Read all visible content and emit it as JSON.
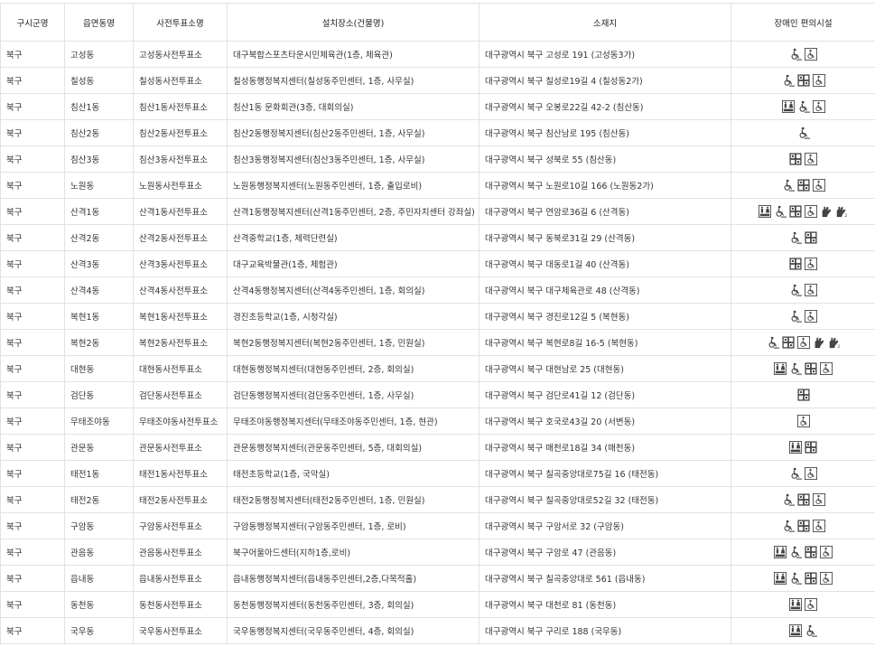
{
  "headers": [
    "구시군명",
    "읍면동명",
    "사전투표소명",
    "설치장소(건물명)",
    "소재지",
    "장애인 편의시설"
  ],
  "rows": [
    {
      "gu": "북구",
      "dong": "고성동",
      "booth": "고성동사전투표소",
      "place": "대구북합스포츠타운시민체육관(1층, 체육관)",
      "addr": "대구광역시 북구 고성로 191 (고성동3가)",
      "icons": [
        "wheelchair-ramp",
        "wheelchair-sign"
      ]
    },
    {
      "gu": "북구",
      "dong": "칠성동",
      "booth": "칠성동사전투표소",
      "place": "칠성동행정복지센터(칠성동주민센터, 1층, 사무실)",
      "addr": "대구광역시 북구 칠성로19길 4 (칠성동2가)",
      "icons": [
        "wheelchair-ramp",
        "elevator",
        "wheelchair-sign"
      ]
    },
    {
      "gu": "북구",
      "dong": "침산1동",
      "booth": "침산1동사전투표소",
      "place": "침산1동 문화회관(3층, 대회의실)",
      "addr": "대구광역시 북구 오봉로22길 42-2 (침산동)",
      "icons": [
        "restroom",
        "wheelchair-ramp",
        "wheelchair-sign"
      ]
    },
    {
      "gu": "북구",
      "dong": "침산2동",
      "booth": "침산2동사전투표소",
      "place": "침산2동행정복지센터(침산2동주민센터, 1층, 사무실)",
      "addr": "대구광역시 북구 침산남로 195 (침산동)",
      "icons": [
        "wheelchair-ramp"
      ]
    },
    {
      "gu": "북구",
      "dong": "침산3동",
      "booth": "침산3동사전투표소",
      "place": "침산3동행정복지센터(침산3동주민센터, 1층, 사무실)",
      "addr": "대구광역시 북구 성북로 55 (침산동)",
      "icons": [
        "elevator",
        "wheelchair-sign"
      ]
    },
    {
      "gu": "북구",
      "dong": "노원동",
      "booth": "노원동사전투표소",
      "place": "노원동행정복지센터(노원동주민센터, 1층, 출입로비)",
      "addr": "대구광역시 북구 노원로10길 166 (노원동2가)",
      "icons": [
        "wheelchair-ramp",
        "elevator",
        "wheelchair-sign"
      ]
    },
    {
      "gu": "북구",
      "dong": "산격1동",
      "booth": "산격1동사전투표소",
      "place": "산격1동행정복지센터(산격1동주민센터, 2층, 주민자치센터 강좌실)",
      "addr": "대구광역시 북구 연암로36길 6 (산격동)",
      "icons": [
        "restroom",
        "wheelchair-ramp",
        "elevator",
        "wheelchair-sign",
        "hand-support",
        "hand-support-2"
      ]
    },
    {
      "gu": "북구",
      "dong": "산격2동",
      "booth": "산격2동사전투표소",
      "place": "산격중학교(1층, 체력단련실)",
      "addr": "대구광역시 북구 동북로31길 29 (산격동)",
      "icons": [
        "wheelchair-ramp",
        "elevator"
      ]
    },
    {
      "gu": "북구",
      "dong": "산격3동",
      "booth": "산격3동사전투표소",
      "place": "대구교육박물관(1층, 체험관)",
      "addr": "대구광역시 북구 대동로1길 40 (산격동)",
      "icons": [
        "elevator",
        "wheelchair-sign"
      ]
    },
    {
      "gu": "북구",
      "dong": "산격4동",
      "booth": "산격4동사전투표소",
      "place": "산격4동행정복지센터(산격4동주민센터, 1층, 회의실)",
      "addr": "대구광역시 북구 대구체육관로 48 (산격동)",
      "icons": [
        "wheelchair-ramp",
        "wheelchair-sign"
      ]
    },
    {
      "gu": "북구",
      "dong": "복현1동",
      "booth": "복현1동사전투표소",
      "place": "경진초등학교(1층, 시청각실)",
      "addr": "대구광역시 북구 경진로12길 5 (복현동)",
      "icons": [
        "wheelchair-ramp",
        "wheelchair-sign"
      ]
    },
    {
      "gu": "북구",
      "dong": "복현2동",
      "booth": "복현2동사전투표소",
      "place": "복현2동행정복지센터(복현2동주민센터, 1층, 민원실)",
      "addr": "대구광역시 북구 복현로8길 16-5 (복현동)",
      "icons": [
        "wheelchair-ramp",
        "elevator",
        "wheelchair-sign",
        "hand-support",
        "hand-support-2"
      ]
    },
    {
      "gu": "북구",
      "dong": "대현동",
      "booth": "대현동사전투표소",
      "place": "대현동행정복지센터(대현동주민센터, 2층, 회의실)",
      "addr": "대구광역시 북구 대현남로 25 (대현동)",
      "icons": [
        "restroom",
        "wheelchair-ramp",
        "elevator",
        "wheelchair-sign"
      ]
    },
    {
      "gu": "북구",
      "dong": "검단동",
      "booth": "검단동사전투표소",
      "place": "검단동행정복지센터(검단동주민센터, 1층, 사무실)",
      "addr": "대구광역시 북구 검단로41길 12 (검단동)",
      "icons": [
        "elevator"
      ]
    },
    {
      "gu": "북구",
      "dong": "무태조야동",
      "booth": "무태조야동사전투표소",
      "place": "무태조야동행정복지센터(무태조야동주민센터, 1층, 현관)",
      "addr": "대구광역시 북구 호국로43길 20 (서변동)",
      "icons": [
        "wheelchair-sign"
      ]
    },
    {
      "gu": "북구",
      "dong": "관문동",
      "booth": "관문동사전투표소",
      "place": "관문동행정복지센터(관문동주민센터, 5층, 대회의실)",
      "addr": "대구광역시 북구 매천로18길 34 (매천동)",
      "icons": [
        "restroom",
        "elevator"
      ]
    },
    {
      "gu": "북구",
      "dong": "태전1동",
      "booth": "태전1동사전투표소",
      "place": "태전초등학교(1층, 국악실)",
      "addr": "대구광역시 북구 칠곡중앙대로75길 16 (태전동)",
      "icons": [
        "wheelchair-ramp",
        "wheelchair-sign"
      ]
    },
    {
      "gu": "북구",
      "dong": "태전2동",
      "booth": "태전2동사전투표소",
      "place": "태전2동행정복지센터(태전2동주민센터, 1층, 민원실)",
      "addr": "대구광역시 북구 칠곡중앙대로52길 32 (태전동)",
      "icons": [
        "wheelchair-ramp",
        "elevator",
        "wheelchair-sign"
      ]
    },
    {
      "gu": "북구",
      "dong": "구암동",
      "booth": "구암동사전투표소",
      "place": "구암동행정복지센터(구암동주민센터, 1층, 로비)",
      "addr": "대구광역시 북구 구암서로 32 (구암동)",
      "icons": [
        "wheelchair-ramp",
        "elevator",
        "wheelchair-sign"
      ]
    },
    {
      "gu": "북구",
      "dong": "관음동",
      "booth": "관음동사전투표소",
      "place": "북구어울아드센터(지하1층,로비)",
      "addr": "대구광역시 북구 구암로 47 (관음동)",
      "icons": [
        "restroom",
        "wheelchair-ramp",
        "elevator",
        "wheelchair-sign"
      ]
    },
    {
      "gu": "북구",
      "dong": "읍내동",
      "booth": "읍내동사전투표소",
      "place": "읍내동행정복지센터(읍내동주민센터,2층,다목적홀)",
      "addr": "대구광역시 북구 칠곡중앙대로 561 (읍내동)",
      "icons": [
        "restroom",
        "wheelchair-ramp",
        "elevator",
        "wheelchair-sign"
      ]
    },
    {
      "gu": "북구",
      "dong": "동천동",
      "booth": "동천동사전투표소",
      "place": "동천동행정복지센터(동천동주민센터, 3층, 회의실)",
      "addr": "대구광역시 북구 대천로 81 (동천동)",
      "icons": [
        "restroom",
        "wheelchair-sign"
      ]
    },
    {
      "gu": "북구",
      "dong": "국우동",
      "booth": "국우동사전투표소",
      "place": "국우동행정복지센터(국우동주민센터, 4층, 회의실)",
      "addr": "대구광역시 북구 구리로 188 (국우동)",
      "icons": [
        "restroom",
        "wheelchair-ramp"
      ]
    }
  ]
}
